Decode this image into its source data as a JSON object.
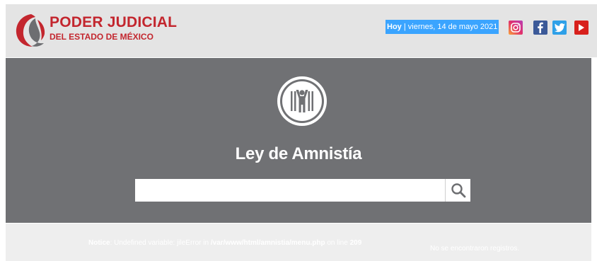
{
  "header": {
    "logo_title": "PODER JUDICIAL",
    "logo_subtitle": "DEL ESTADO DE MÉXICO",
    "date_prefix": "Hoy",
    "date_separator": " | ",
    "date_text": "viernes, 14 de mayo 2021",
    "social": [
      {
        "icon": "instagram-icon",
        "color": "#e1306c"
      },
      {
        "icon": "facebook-icon",
        "color": "#3b5998"
      },
      {
        "icon": "twitter-icon",
        "color": "#2ea0e8"
      },
      {
        "icon": "youtube-icon",
        "color": "#d8201c"
      }
    ]
  },
  "hero": {
    "title": "Ley de Amnistía",
    "search": {
      "value": "",
      "placeholder": "",
      "button_icon": "search-icon"
    },
    "background_color": "#707174"
  },
  "notice": {
    "label": "Notice",
    "message": ": Undefined variable: jileError in ",
    "path": "/var/www/html/amnistia/menu.php",
    "line_text": " on line ",
    "line": "209",
    "no_records": "No se encontraron registros."
  },
  "colors": {
    "brand_red": "#c3262e",
    "header_bg": "#e4e4e4",
    "date_highlight": "#3aa4ff"
  }
}
